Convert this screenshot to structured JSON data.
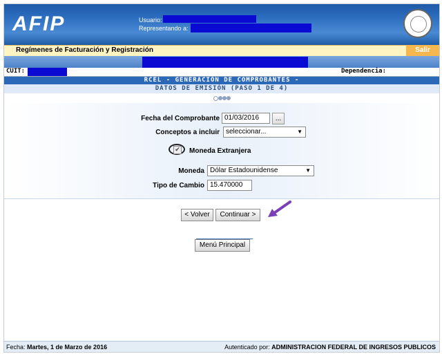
{
  "header": {
    "logo": "AFIP",
    "usuario_label": "Usuario:",
    "representando_label": "Representando a:",
    "seal": "AFIP"
  },
  "menubar": {
    "title": "Regímenes de Facturación y Registración",
    "salir": "Salir"
  },
  "cuitbar": {
    "cuit_label": "CUIT:",
    "dependencia_label": "Dependencia:"
  },
  "section": {
    "title": "RCEL - GENERACIÓN DE COMPROBANTES -",
    "subtitle": "DATOS DE EMISIÓN (PASO 1 DE 4)",
    "steps_total": 4,
    "steps_current": 1
  },
  "form": {
    "fecha_label": "Fecha del Comprobante",
    "fecha_value": "01/03/2016",
    "fecha_btn": "...",
    "conceptos_label": "Conceptos a incluir",
    "conceptos_value": "seleccionar...",
    "moneda_ext_label": "Moneda Extranjera",
    "moneda_ext_checked": true,
    "moneda_label": "Moneda",
    "moneda_value": "Dólar Estadounidense",
    "tipo_cambio_label": "Tipo de Cambio",
    "tipo_cambio_value": "15.470000"
  },
  "buttons": {
    "volver": "< Volver",
    "continuar": "Continuar >",
    "menu_principal": "Menú Principal"
  },
  "footer": {
    "fecha_label": "Fecha:",
    "fecha_value": "Martes, 1 de Marzo de 2016",
    "auth_label": "Autenticado por:",
    "auth_value": "ADMINISTRACION FEDERAL DE INGRESOS PUBLICOS"
  },
  "colors": {
    "header_blue": "#2e6fc0",
    "redaction": "#0a0ad2",
    "menubar_bg": "#fff4c2",
    "salir_bg": "#f5b74e",
    "arrow": "#7a3fb5"
  }
}
